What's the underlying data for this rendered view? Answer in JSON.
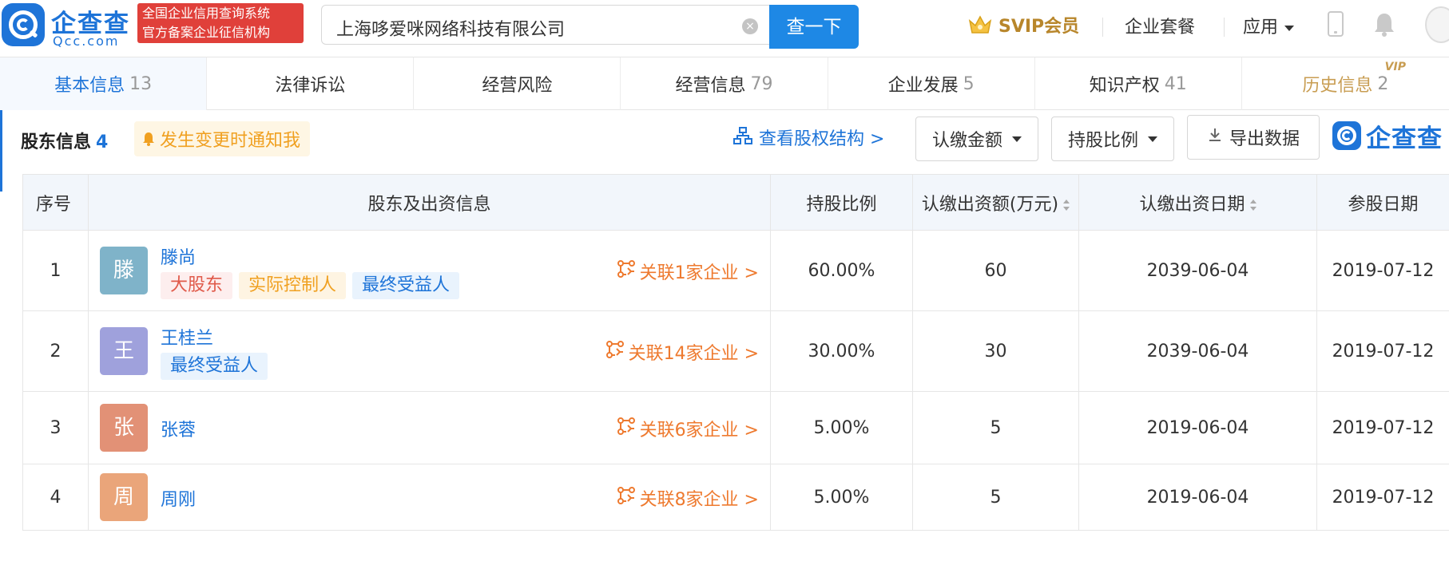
{
  "header": {
    "logo_cn": "企查查",
    "logo_en": "Qcc.com",
    "badge_line1": "全国企业信用查询系统",
    "badge_line2": "官方备案企业征信机构",
    "search_value": "上海哆爱咪网络科技有限公司",
    "search_button": "查一下",
    "svip_label": "SVIP会员",
    "nav_package": "企业套餐",
    "nav_apps": "应用"
  },
  "tabs": [
    {
      "label": "基本信息",
      "count": "13"
    },
    {
      "label": "法律诉讼",
      "count": ""
    },
    {
      "label": "经营风险",
      "count": ""
    },
    {
      "label": "经营信息",
      "count": "79"
    },
    {
      "label": "企业发展",
      "count": "5"
    },
    {
      "label": "知识产权",
      "count": "41"
    },
    {
      "label": "历史信息",
      "count": "2"
    }
  ],
  "vip_tag": "VIP",
  "section": {
    "title": "股东信息",
    "count": "4",
    "notify_label": "发生变更时通知我",
    "equity_link": "查看股权结构 >",
    "dropdown_amount": "认缴金额",
    "dropdown_ratio": "持股比例",
    "export_label": "导出数据",
    "brand_name": "企查查"
  },
  "table": {
    "headers": {
      "index": "序号",
      "holder": "股东及出资信息",
      "ratio": "持股比例",
      "amount": "认缴出资额(万元)",
      "date": "认缴出资日期",
      "join_date": "参股日期"
    },
    "rows": [
      {
        "index": "1",
        "avatar": "滕",
        "avatar_color": "#7fb3c9",
        "name": "滕尚",
        "tags": [
          "大股东",
          "实际控制人",
          "最终受益人"
        ],
        "related": "关联1家企业 >",
        "ratio": "60.00%",
        "amount": "60",
        "date": "2039-06-04",
        "join_date": "2019-07-12"
      },
      {
        "index": "2",
        "avatar": "王",
        "avatar_color": "#9fa1dc",
        "name": "王桂兰",
        "tags": [
          "最终受益人"
        ],
        "related": "关联14家企业 >",
        "ratio": "30.00%",
        "amount": "30",
        "date": "2039-06-04",
        "join_date": "2019-07-12"
      },
      {
        "index": "3",
        "avatar": "张",
        "avatar_color": "#e29176",
        "name": "张蓉",
        "tags": [],
        "related": "关联6家企业 >",
        "ratio": "5.00%",
        "amount": "5",
        "date": "2019-06-04",
        "join_date": "2019-07-12"
      },
      {
        "index": "4",
        "avatar": "周",
        "avatar_color": "#eaa57a",
        "name": "周刚",
        "tags": [],
        "related": "关联8家企业 >",
        "ratio": "5.00%",
        "amount": "5",
        "date": "2019-06-04",
        "join_date": "2019-07-12"
      }
    ]
  },
  "colors": {
    "brand": "#1e74d8",
    "search_button": "#1e88e5",
    "badge": "#e0403a",
    "svip": "#b8862b",
    "related_link": "#ee7a2f"
  }
}
